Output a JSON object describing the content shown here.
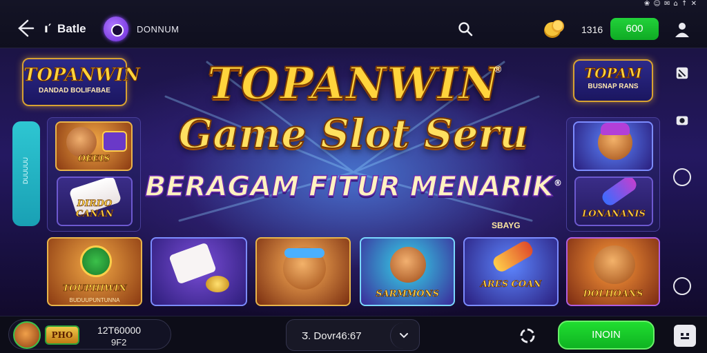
{
  "status_bar": {
    "icons": "❀ ☺ ✉ ⌂ ↑ ✕"
  },
  "header": {
    "title_glyph": "ı′",
    "title": "Batle",
    "brand_name": "DONNUM",
    "coin_amount": "1316",
    "deposit_label": "600"
  },
  "banner": {
    "logo_left_title": "TOPANWIN",
    "logo_left_sub": "DANDAD BOLIFABAE",
    "logo_right_title": "TOPAM",
    "logo_right_sub": "BUSNAP RANS",
    "headline": "TOPANWIN",
    "trademark": "®",
    "subheadline": "Game Slot Seru",
    "tagline": "BERAGAM FITUR MENARIK",
    "tagline_mark": "®",
    "small_note": "SBAYG",
    "side_tab": "DUUUUU"
  },
  "tiles": {
    "top_left_label": "OEEIS",
    "mid_left_label": "DIRDO CANAN",
    "top_right_label": "",
    "mid_right_label": "LONANANIS",
    "row": [
      {
        "label": "TOUPHIWIN",
        "sub": "BUDUUPUNTUNNA"
      },
      {
        "label": "",
        "sub": ""
      },
      {
        "label": "",
        "sub": ""
      },
      {
        "label": "SARMMONS",
        "sub": ""
      },
      {
        "label": "ARES COAN",
        "sub": ""
      },
      {
        "label": "DOLHOANS",
        "sub": ""
      }
    ]
  },
  "footer": {
    "level_label": "PHO",
    "balance_top": "12T60000",
    "balance_bottom": "9F2",
    "timer_text": "Ӡ. Dovr46:67",
    "join_label": "INOIN"
  },
  "colors": {
    "accent_green": "#16c02a",
    "gold": "#ffd43c",
    "purple": "#3b2a8c"
  }
}
